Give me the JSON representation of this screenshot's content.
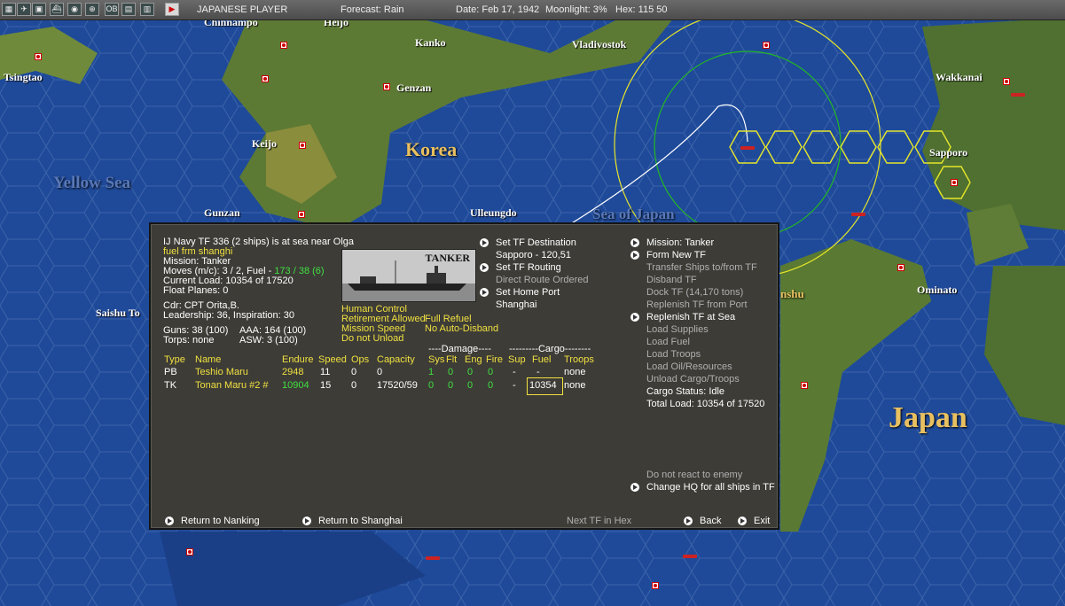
{
  "toolbar": {
    "side": "JAPANESE PLAYER",
    "forecast": "Forecast: Rain",
    "date": "Date: Feb 17, 1942",
    "moonlight": "Moonlight: 3%",
    "hex": "Hex: 115 50"
  },
  "map": {
    "places": [
      "Chinnampo",
      "Heijo",
      "Kanko",
      "Vladivostok",
      "Wakkanai",
      "Tsingtao",
      "Genzan",
      "Keijo",
      "Sapporo",
      "Gunzan",
      "Ulleungdo",
      "Ominato",
      "Saishu To",
      "Shanghai"
    ],
    "regions": [
      "Korea",
      "Yellow Sea",
      "Sea of Japan",
      "Japan",
      "nshu"
    ]
  },
  "panel": {
    "tf_title": "IJ Navy TF 336 (2 ships) is at sea near Olga",
    "tf_subtitle": "fuel frm shanghi",
    "mission": "Mission: Tanker",
    "moves_prefix": "Moves (m/c): 3 / 2, Fuel - ",
    "moves_fuel": "173 / 38 (6)",
    "current_load": "Current Load: 10354 of 17520",
    "float_planes": "Float Planes: 0",
    "cdr": "Cdr: CPT  Orita,B.",
    "leadership": "Leadership: 36, Inspiration: 30",
    "guns": "Guns: 38 (100)",
    "aaa": "AAA: 164 (100)",
    "torps": "Torps: none",
    "asw": "ASW: 3 (100)",
    "image_label": "TANKER",
    "flags": {
      "human_control": "Human Control",
      "retirement": "Retirement Allowed",
      "full_refuel": "Full Refuel",
      "mission_speed": "Mission Speed",
      "no_auto_disband": "No Auto-Disband",
      "do_not_unload": "Do not Unload"
    },
    "mid_menu": {
      "set_destination": "Set TF Destination",
      "destination": "Sapporo - 120,51",
      "set_routing": "Set TF Routing",
      "direct_route": "Direct Route Ordered",
      "set_home": "Set Home Port",
      "home": "Shanghai"
    },
    "right_menu": {
      "mission": "Mission: Tanker",
      "form_new": "Form New TF",
      "transfer": "Transfer Ships to/from TF",
      "disband": "Disband TF",
      "dock": "Dock TF (14,170 tons)",
      "replenish_port": "Replenish TF from Port",
      "replenish_sea": "Replenish TF at Sea",
      "load_supplies": "Load Supplies",
      "load_fuel": "Load Fuel",
      "load_troops": "Load Troops",
      "load_oil": "Load Oil/Resources",
      "unload": "Unload Cargo/Troops",
      "cargo_status": "Cargo Status: Idle",
      "total_load": "Total Load: 10354 of 17520",
      "no_react": "Do not react to enemy",
      "change_hq": "Change HQ for all ships in TF"
    },
    "table": {
      "damage_header": "----Damage----",
      "cargo_header": "---------Cargo--------",
      "columns": [
        "Type",
        "Name",
        "Endure",
        "Speed",
        "Ops",
        "Capacity",
        "Sys",
        "Flt",
        "Eng",
        "Fire",
        "Sup",
        "Fuel",
        "Troops"
      ],
      "rows": [
        {
          "type": "PB",
          "name": "Teshio Maru",
          "endure": "2948",
          "speed": "11",
          "ops": "0",
          "capacity": "0",
          "sys": "1",
          "flt": "0",
          "eng": "0",
          "fire": "0",
          "sup": "-",
          "fuel": "-",
          "troops": "none"
        },
        {
          "type": "TK",
          "name": "Tonan Maru #2 #",
          "endure": "10904",
          "speed": "15",
          "ops": "0",
          "capacity": "17520/59",
          "sys": "0",
          "flt": "0",
          "eng": "0",
          "fire": "0",
          "sup": "-",
          "fuel": "10354",
          "troops": "none"
        }
      ]
    },
    "bottom": {
      "return_nanking": "Return to Nanking",
      "return_shanghai": "Return to Shanghai",
      "next_tf": "Next TF in Hex",
      "back": "Back",
      "exit": "Exit"
    }
  }
}
